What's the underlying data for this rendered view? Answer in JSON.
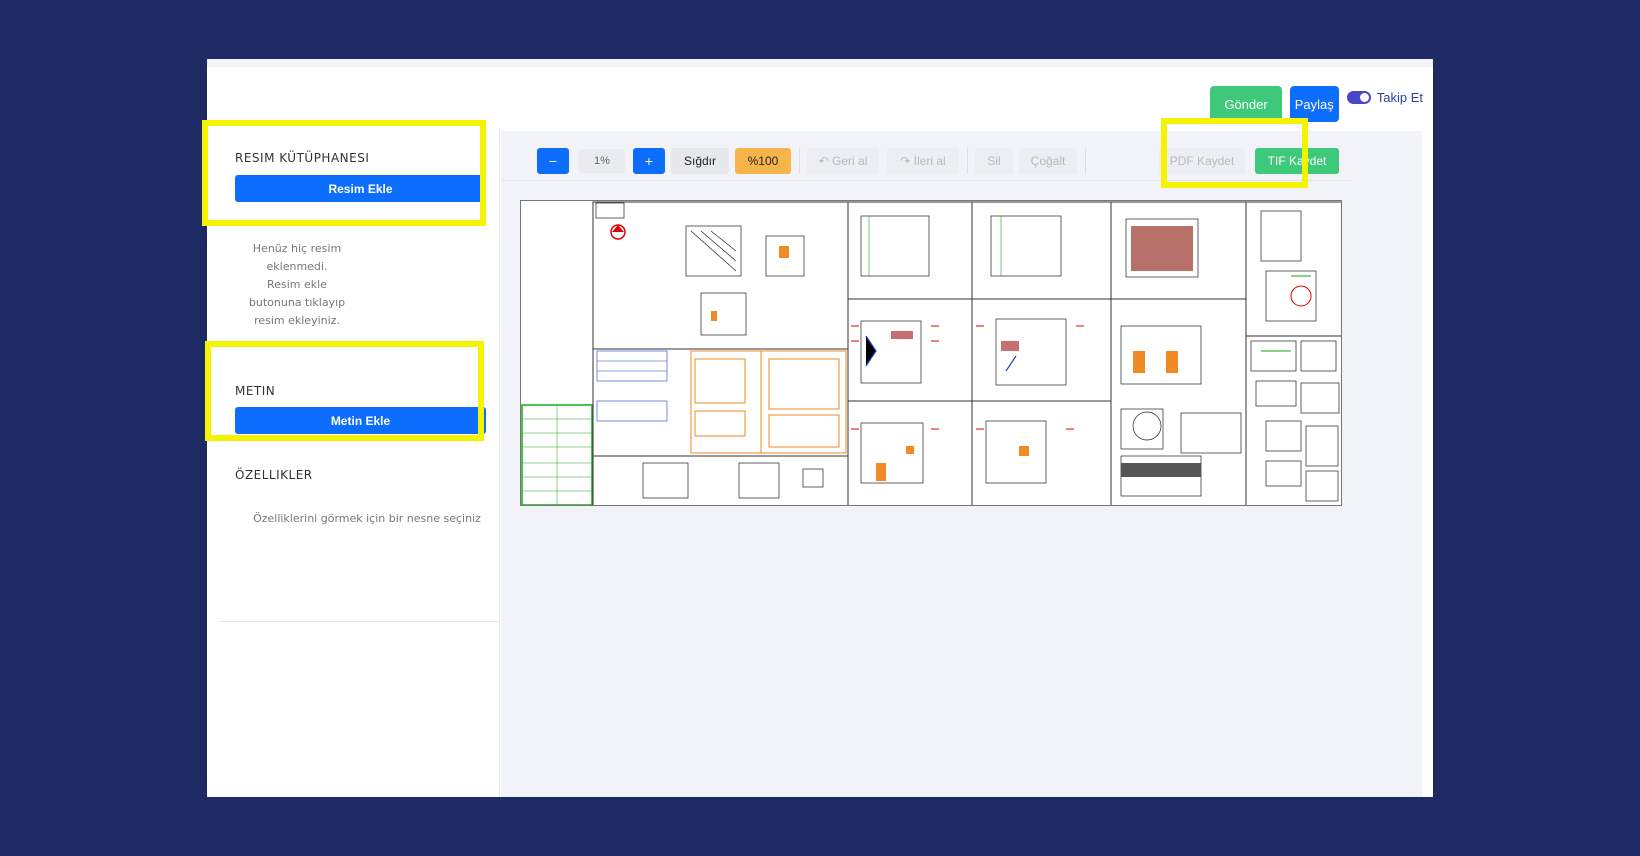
{
  "header": {
    "send_label": "Gönder",
    "share_label": "Paylaş",
    "follow_label": "Takip Et"
  },
  "sidebar": {
    "image_library": {
      "title": "RESIM KÜTÜPHANESI",
      "add_button": "Resim Ekle",
      "empty_lines": [
        "Henüz hiç resim",
        "eklenmedi.",
        "Resim ekle",
        "butonuna tıklayıp",
        "resim ekleyiniz."
      ]
    },
    "text": {
      "title": "METIN",
      "add_button": "Metin Ekle"
    },
    "properties": {
      "title": "ÖZELLIKLER",
      "empty_message": "Özelliklerini görmek için bir nesne seçiniz"
    }
  },
  "toolbar": {
    "zoom_out": "−",
    "zoom_value": "1%",
    "zoom_in": "+",
    "fit": "Sığdır",
    "hundred": "%100",
    "undo": "↶ Geri al",
    "redo": "↷ İleri al",
    "delete": "Sil",
    "duplicate": "Çoğalt",
    "pdf_save": "PDF Kaydet",
    "tif_save": "TIF Kaydet"
  },
  "colors": {
    "background": "#1e2a63",
    "primary": "#0d6efd",
    "success": "#3ec87a",
    "warning": "#f6b44a",
    "highlight": "#f4f400"
  },
  "icons": {
    "follow_toggle": "toggle-switch-on",
    "undo": "undo-arrow",
    "redo": "redo-arrow"
  }
}
